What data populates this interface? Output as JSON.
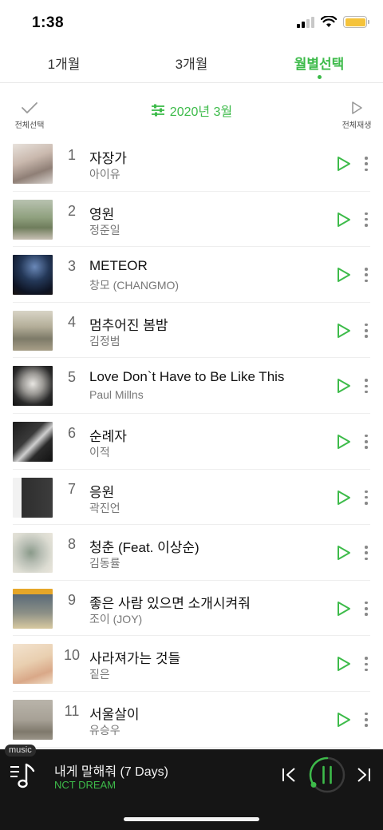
{
  "status": {
    "time": "1:38"
  },
  "tabs": [
    {
      "label": "1개월"
    },
    {
      "label": "3개월"
    },
    {
      "label": "월별선택"
    }
  ],
  "toolbar": {
    "select_all": "전체선택",
    "filter_label": "2020년 3월",
    "play_all": "전체재생"
  },
  "colors": {
    "accent": "#3dbb4a",
    "player_bg": "#151515"
  },
  "songs": [
    {
      "rank": "1",
      "title": "자장가",
      "artist": "아이유"
    },
    {
      "rank": "2",
      "title": "영원",
      "artist": "정준일"
    },
    {
      "rank": "3",
      "title": "METEOR",
      "artist": "창모 (CHANGMO)"
    },
    {
      "rank": "4",
      "title": "멈추어진 봄밤",
      "artist": "김정범"
    },
    {
      "rank": "5",
      "title": "Love Don`t Have to Be Like This",
      "artist": "Paul Millns"
    },
    {
      "rank": "6",
      "title": "순례자",
      "artist": "이적"
    },
    {
      "rank": "7",
      "title": "응원",
      "artist": "곽진언"
    },
    {
      "rank": "8",
      "title": "청춘 (Feat. 이상순)",
      "artist": "김동률"
    },
    {
      "rank": "9",
      "title": "좋은 사람 있으면 소개시켜줘",
      "artist": "조이 (JOY)"
    },
    {
      "rank": "10",
      "title": "사라져가는 것들",
      "artist": "짙은"
    },
    {
      "rank": "11",
      "title": "서울살이",
      "artist": "유승우"
    }
  ],
  "player": {
    "badge": "music",
    "title": "내게 말해줘 (7 Days)",
    "artist": "NCT DREAM",
    "progress": 0.35
  }
}
